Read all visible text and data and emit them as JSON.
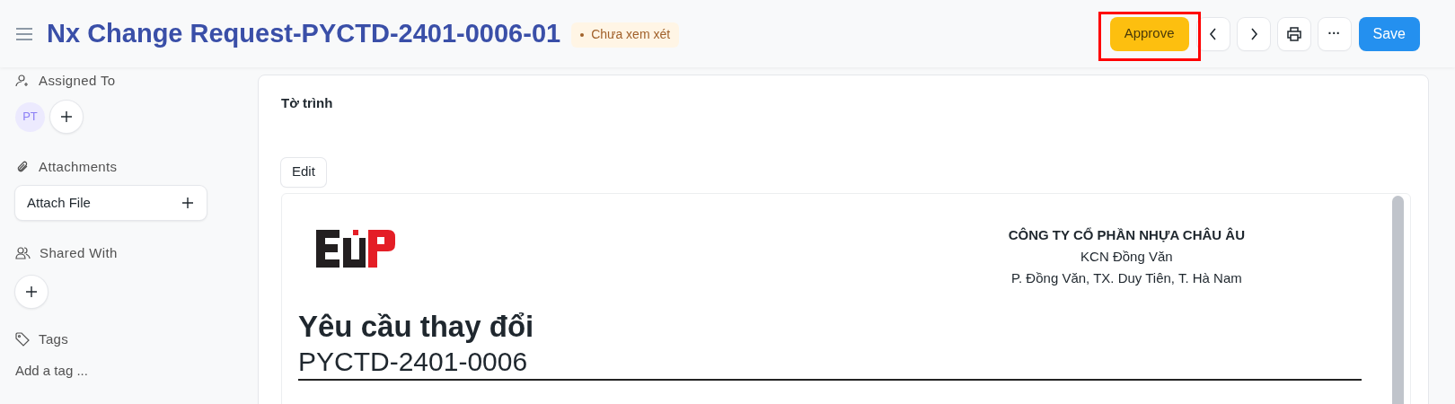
{
  "header": {
    "title": "Nx Change Request-PYCTD-2401-0006-01",
    "status": {
      "label": "Chưa xem xét",
      "color": "#a0612a"
    },
    "actions": [
      {
        "kind": "primary-warning",
        "label": "Approve",
        "highlighted": true
      },
      {
        "kind": "prev"
      },
      {
        "kind": "next"
      },
      {
        "kind": "print"
      },
      {
        "kind": "more",
        "label": "···"
      },
      {
        "kind": "primary",
        "label": "Save"
      }
    ]
  },
  "sidebar": {
    "assigned_to": {
      "heading": "Assigned To",
      "avatars": [
        "PT"
      ]
    },
    "attachments": {
      "heading": "Attachments",
      "button": "Attach File"
    },
    "shared_with": {
      "heading": "Shared With"
    },
    "tags": {
      "heading": "Tags",
      "placeholder": "Add a tag ..."
    }
  },
  "form": {
    "section_title": "Tờ trình",
    "edit_button": "Edit",
    "document": {
      "company": [
        "CÔNG TY CỔ PHẦN NHỰA CHÂU ÂU",
        "KCN Đồng Văn",
        "P. Đồng Văn, TX. Duy Tiên, T. Hà Nam"
      ],
      "title": "Yêu cầu thay đổi",
      "number": "PYCTD-2401-0006"
    }
  }
}
